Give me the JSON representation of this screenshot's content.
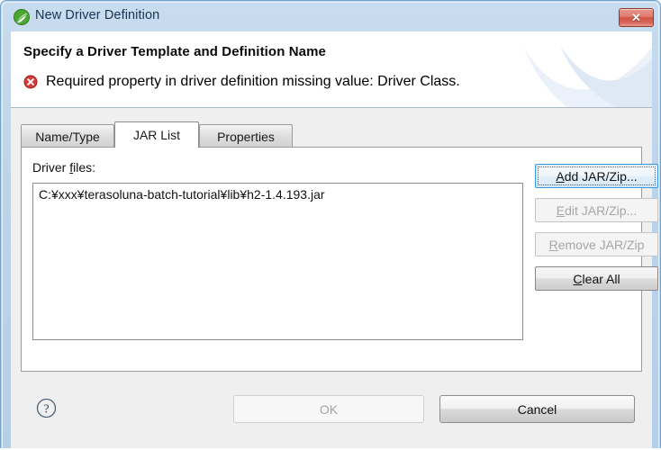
{
  "window": {
    "title": "New Driver Definition",
    "title_icon": "spring-leaf-icon",
    "close_label": "✕",
    "accent_title_bg": "#bcd4ea",
    "border_color": "#6fa5cd"
  },
  "header": {
    "title": "Specify a Driver Template and Definition Name",
    "status_icon": "error-icon",
    "status_message": "Required property in driver definition missing value: Driver Class.",
    "status_color": "#cc2d2d"
  },
  "tabs": [
    {
      "label": "Name/Type",
      "active": false
    },
    {
      "label": "JAR List",
      "active": true
    },
    {
      "label": "Properties",
      "active": false
    }
  ],
  "jar_list_tab": {
    "files_label_pre": "Driver ",
    "files_label_mn": "f",
    "files_label_post": "iles:",
    "files": [
      "C:¥xxx¥terasoluna-batch-tutorial¥lib¥h2-1.4.193.jar"
    ],
    "buttons": [
      {
        "mn": "A",
        "rest": "dd JAR/Zip...",
        "state": "focused"
      },
      {
        "mn": "E",
        "rest": "dit JAR/Zip...",
        "state": "disabled"
      },
      {
        "mn": "R",
        "rest": "emove JAR/Zip",
        "state": "disabled"
      },
      {
        "mn": "C",
        "rest": "lear All",
        "state": "enabled"
      }
    ]
  },
  "footer": {
    "help_icon": "help-question-icon",
    "ok_label": "OK",
    "ok_enabled": false,
    "cancel_label": "Cancel",
    "cancel_enabled": true
  }
}
